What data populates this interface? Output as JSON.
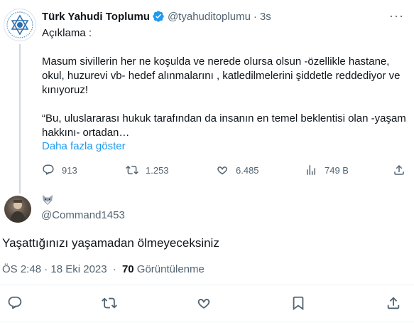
{
  "quoted_tweet": {
    "author_name": "Türk Yahudi Toplumu",
    "author_handle": "@tyahuditoplumu",
    "separator": "·",
    "time": "3s",
    "paragraphs": [
      "Açıklama :",
      "Masum sivillerin her ne koşulda ve nerede olursa olsun -özellikle hastane, okul, huzurevi vb- hedef alınmalarını , katledilmelerini şiddetle reddediyor ve kınıyoruz!",
      "“Bu, uluslararası hukuk tarafından da insanın en temel beklentisi olan -yaşam hakkını- ortadan…"
    ],
    "show_more": "Daha fazla göster",
    "stats": {
      "replies": "913",
      "reposts": "1.253",
      "likes": "6.485",
      "views": "749 B"
    }
  },
  "reply_tweet": {
    "author_handle": "@Command1453",
    "text": "Yaşattığınızı yaşamadan ölmeyeceksiniz",
    "timestamp": "ÖS 2:48 · 18 Eki 2023",
    "separator": "·",
    "views_count": "70",
    "views_label": "Görüntülenme"
  },
  "colors": {
    "text": "#0f1419",
    "secondary": "#536471",
    "accent": "#1d9bf0",
    "divider": "#eff3f4"
  },
  "icons": [
    "star-of-david-logo-icon",
    "verified-badge-icon",
    "more-icon",
    "reply-icon",
    "repost-icon",
    "like-icon",
    "views-icon",
    "share-icon",
    "wolf-emoji-icon"
  ]
}
